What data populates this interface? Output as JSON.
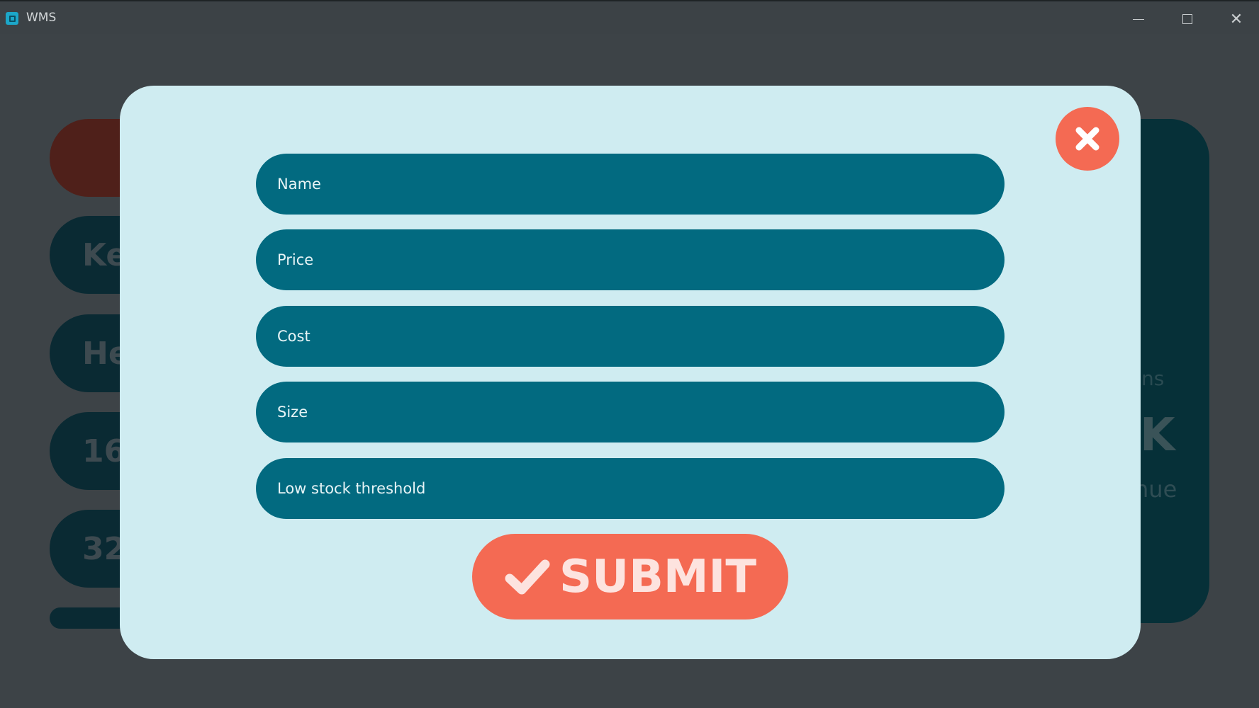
{
  "window": {
    "title": "WMS",
    "app_icon": "wms-app-icon",
    "controls": [
      "minimize-icon",
      "maximize-icon",
      "close-icon"
    ]
  },
  "background": {
    "pills": [
      "",
      "Ke",
      "He",
      "16",
      "32"
    ],
    "panel": {
      "text_1": "ns",
      "text_2": "K",
      "text_3": "nue"
    }
  },
  "modal": {
    "close_icon": "x-icon",
    "fields": [
      {
        "placeholder": "Name"
      },
      {
        "placeholder": "Price"
      },
      {
        "placeholder": "Cost"
      },
      {
        "placeholder": "Size"
      },
      {
        "placeholder": "Low stock threshold"
      }
    ],
    "submit": {
      "icon": "checkmark-icon",
      "label": "SUBMIT"
    }
  },
  "colors": {
    "backdrop": "#3d4347",
    "modal_bg": "#cfecf1",
    "field_bg": "#026a80",
    "accent": "#f46a53",
    "submit_text": "#fde3df"
  }
}
